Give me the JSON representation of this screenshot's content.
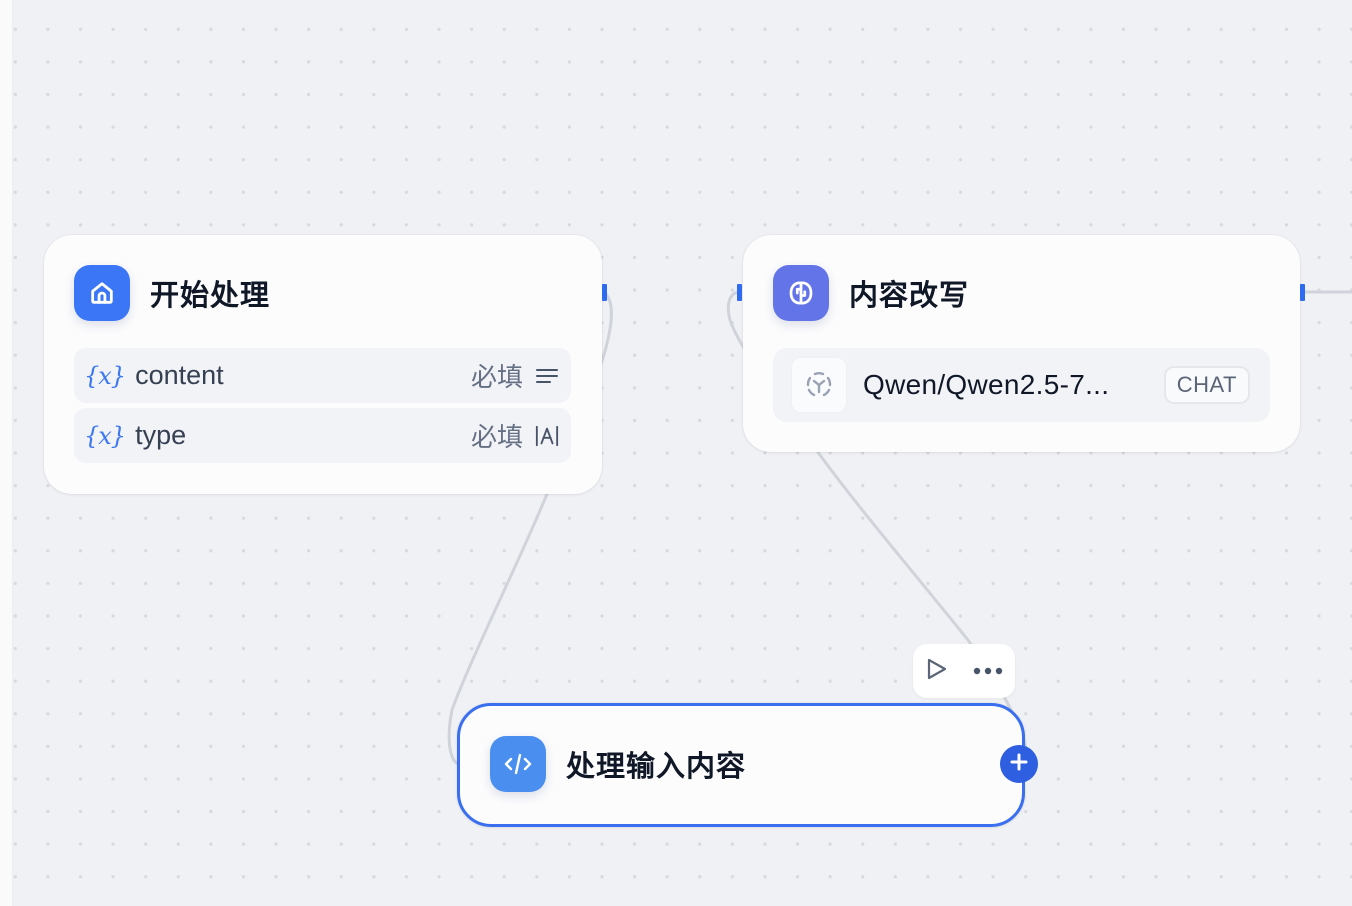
{
  "colors": {
    "canvas_bg": "#f0f1f5",
    "accent_blue": "#3a6ff0",
    "start_icon_bg": "#3b76f6",
    "llm_icon_bg": "#6373e8",
    "code_icon_bg": "#4a8ef0",
    "edge": "#d0d4da"
  },
  "nodes": {
    "start": {
      "title": "开始处理",
      "icon": "home-icon",
      "variables": [
        {
          "icon": "{x}",
          "name": "content",
          "required": "必填",
          "type_icon": "paragraph-icon"
        },
        {
          "icon": "{x}",
          "name": "type",
          "required": "必填",
          "type_icon": "text-input-icon"
        }
      ]
    },
    "llm": {
      "title": "内容改写",
      "icon": "brain-icon",
      "model": {
        "icon": "model-provider-icon",
        "name": "Qwen/Qwen2.5-7...",
        "badge": "CHAT"
      }
    },
    "code": {
      "title": "处理输入内容",
      "icon": "code-icon",
      "selected": true
    }
  },
  "node_toolbar": {
    "run_icon": "play-icon",
    "more_icon": "more-horizontal-icon"
  },
  "add_button": {
    "icon": "plus-icon"
  }
}
